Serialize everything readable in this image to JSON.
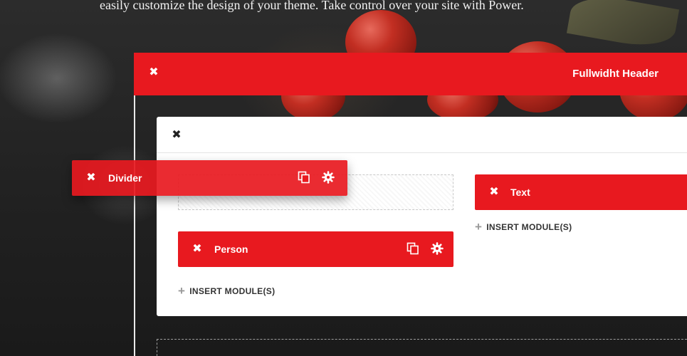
{
  "page": {
    "tagline": "easily customize the design of your theme. Take control over your site with Power."
  },
  "section": {
    "title": "Fullwidht Header"
  },
  "left_column": {
    "person_module": {
      "label": "Person"
    },
    "insert_label": "INSERT MODULE(S)"
  },
  "right_column": {
    "text_module": {
      "label": "Text"
    },
    "insert_label": "INSERT MODULE(S)"
  },
  "dragged_module": {
    "label": "Divider"
  },
  "colors": {
    "accent": "#e8191f",
    "panel": "#ffffff",
    "text_dark": "#333333"
  },
  "icons": {
    "close": "close-icon",
    "duplicate": "duplicate-icon",
    "settings": "gear-icon",
    "add": "plus-icon"
  }
}
